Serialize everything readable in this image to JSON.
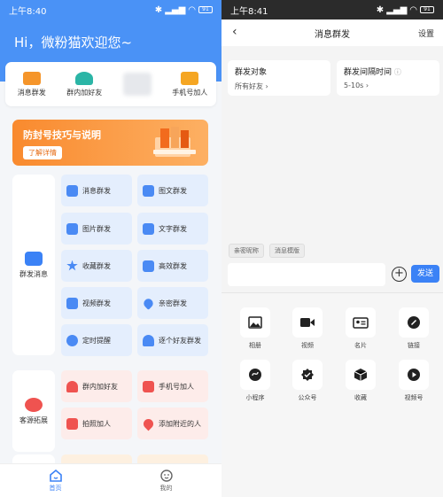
{
  "left": {
    "status": {
      "time": "上午8:40",
      "battery": "91"
    },
    "greeting": "Hi，微粉猫欢迎您~",
    "quick": [
      {
        "label": "消息群发",
        "icon": "envelope-icon",
        "color": "#f5952a"
      },
      {
        "label": "群内加好友",
        "icon": "group-users-icon",
        "color": "#2bb5a6"
      },
      {
        "label": "",
        "icon": "blurred-icon",
        "color": "#e6e8ec"
      },
      {
        "label": "手机号加人",
        "icon": "contact-card-icon",
        "color": "#f5a623"
      }
    ],
    "banner": {
      "title": "防封号技巧与说明",
      "button": "了解详情"
    },
    "groups": [
      {
        "label": "群发消息",
        "icon": "chat-bubble-icon",
        "color": "#3b82f6"
      },
      {
        "label": "客源拓展",
        "icon": "add-user-icon",
        "color": "#ef5350"
      }
    ],
    "tiles": [
      {
        "label": "消息群发",
        "icon": "envelope-icon",
        "color": "#4a8af4"
      },
      {
        "label": "图文群发",
        "icon": "image-text-icon",
        "color": "#4a8af4"
      },
      {
        "label": "图片群发",
        "icon": "picture-icon",
        "color": "#4a8af4"
      },
      {
        "label": "文字群发",
        "icon": "text-icon",
        "color": "#4a8af4"
      },
      {
        "label": "收藏群发",
        "icon": "star-icon",
        "color": "#4a8af4"
      },
      {
        "label": "高效群发",
        "icon": "rocket-icon",
        "color": "#4a8af4"
      },
      {
        "label": "视频群发",
        "icon": "video-icon",
        "color": "#4a8af4"
      },
      {
        "label": "亲密群发",
        "icon": "heart-icon",
        "color": "#4a8af4"
      },
      {
        "label": "定时提醒",
        "icon": "alarm-clock-icon",
        "color": "#4a8af4"
      },
      {
        "label": "逐个好友群发",
        "icon": "person-icon",
        "color": "#4a8af4"
      },
      {
        "label": "群内加好友",
        "icon": "group-users-icon",
        "color": "#ef5350"
      },
      {
        "label": "手机号加人",
        "icon": "contact-card-icon",
        "color": "#ef5350"
      },
      {
        "label": "拍照加人",
        "icon": "camera-icon",
        "color": "#ef5350"
      },
      {
        "label": "添加附近的人",
        "icon": "location-pin-icon",
        "color": "#ef5350"
      }
    ],
    "tabs": [
      {
        "label": "首页",
        "icon": "home-icon"
      },
      {
        "label": "我的",
        "icon": "profile-icon"
      }
    ]
  },
  "right": {
    "status": {
      "time": "上午8:41",
      "battery": "91"
    },
    "title": "消息群发",
    "settings": "设置",
    "target": {
      "title": "群发对象",
      "value": "所有好友"
    },
    "interval": {
      "title": "群发间隔时间",
      "value": "5-10s"
    },
    "chips": [
      "亲密昵称",
      "消息模版"
    ],
    "send": "发送",
    "panel": [
      {
        "label": "相册",
        "icon": "album-icon"
      },
      {
        "label": "视频",
        "icon": "video-camera-icon"
      },
      {
        "label": "名片",
        "icon": "contact-card-icon"
      },
      {
        "label": "链接",
        "icon": "link-icon"
      },
      {
        "label": "小程序",
        "icon": "mini-program-icon"
      },
      {
        "label": "公众号",
        "icon": "official-account-icon"
      },
      {
        "label": "收藏",
        "icon": "cube-icon"
      },
      {
        "label": "视频号",
        "icon": "channels-icon"
      }
    ]
  }
}
